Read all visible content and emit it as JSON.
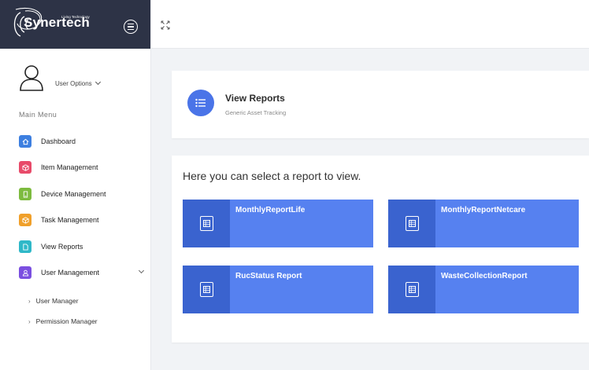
{
  "brand": {
    "name": "Synertech",
    "tagline": "Living Technology"
  },
  "user": {
    "options_label": "User Options"
  },
  "sidebar": {
    "menu_header": "Main Menu",
    "items": [
      {
        "label": "Dashboard",
        "color": "#3d7fe0",
        "icon": "home-icon"
      },
      {
        "label": "Item Management",
        "color": "#e84b6a",
        "icon": "cube-icon"
      },
      {
        "label": "Device Management",
        "color": "#7dbb3f",
        "icon": "device-icon"
      },
      {
        "label": "Task Management",
        "color": "#f0a02a",
        "icon": "box-icon"
      },
      {
        "label": "View Reports",
        "color": "#2fb8c8",
        "icon": "document-icon"
      },
      {
        "label": "User Management",
        "color": "#7b4fe0",
        "icon": "user-icon"
      }
    ],
    "sub_items": [
      {
        "label": "User Manager"
      },
      {
        "label": "Permission Manager"
      }
    ]
  },
  "header_card": {
    "title": "View Reports",
    "subtitle": "Generic Asset Tracking",
    "icon": "list-icon",
    "accent": "#4a74e8"
  },
  "reports": {
    "heading": "Here you can select a report to view.",
    "tiles": [
      {
        "label": "MonthlyReportLife"
      },
      {
        "label": "MonthlyReportNetcare"
      },
      {
        "label": "RucStatus Report"
      },
      {
        "label": "WasteCollectionReport"
      }
    ],
    "tile_color": "#5681f0",
    "tile_side_color": "#3a63cf"
  },
  "colors": {
    "brand_bar": "#2d3346",
    "background": "#f1f3f6"
  }
}
